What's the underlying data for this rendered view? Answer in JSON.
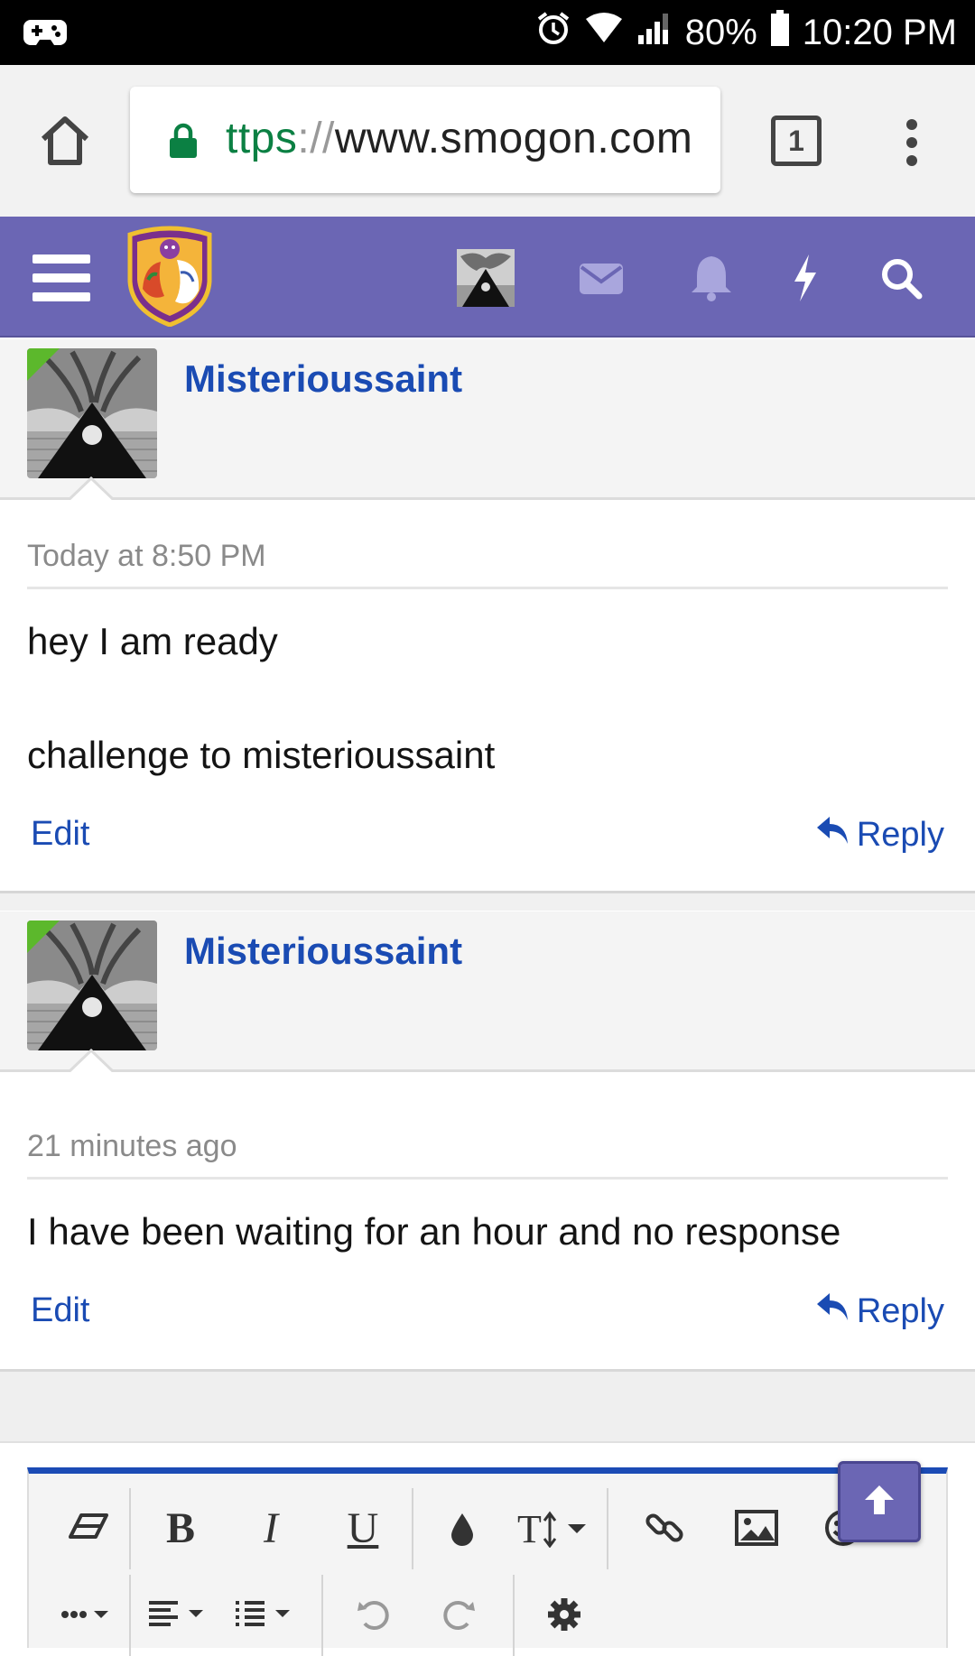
{
  "status_bar": {
    "battery": "80%",
    "time": "10:20 PM"
  },
  "browser": {
    "url_scheme": "ttps",
    "url_sep": "://",
    "url_host": "www.smogon.com",
    "tab_count": "1"
  },
  "posts": [
    {
      "username": "Misterioussaint",
      "date": "Today at 8:50 PM",
      "lines": [
        "hey I am ready",
        "challenge to misterioussaint"
      ],
      "edit_label": "Edit",
      "reply_label": "Reply"
    },
    {
      "username": "Misterioussaint",
      "date": "21 minutes ago",
      "lines": [
        "I have been waiting for an hour and no response"
      ],
      "edit_label": "Edit",
      "reply_label": "Reply"
    }
  ],
  "colors": {
    "header": "#6b66b4",
    "link": "#1a4bb3",
    "editor_accent": "#1b4bb5"
  }
}
